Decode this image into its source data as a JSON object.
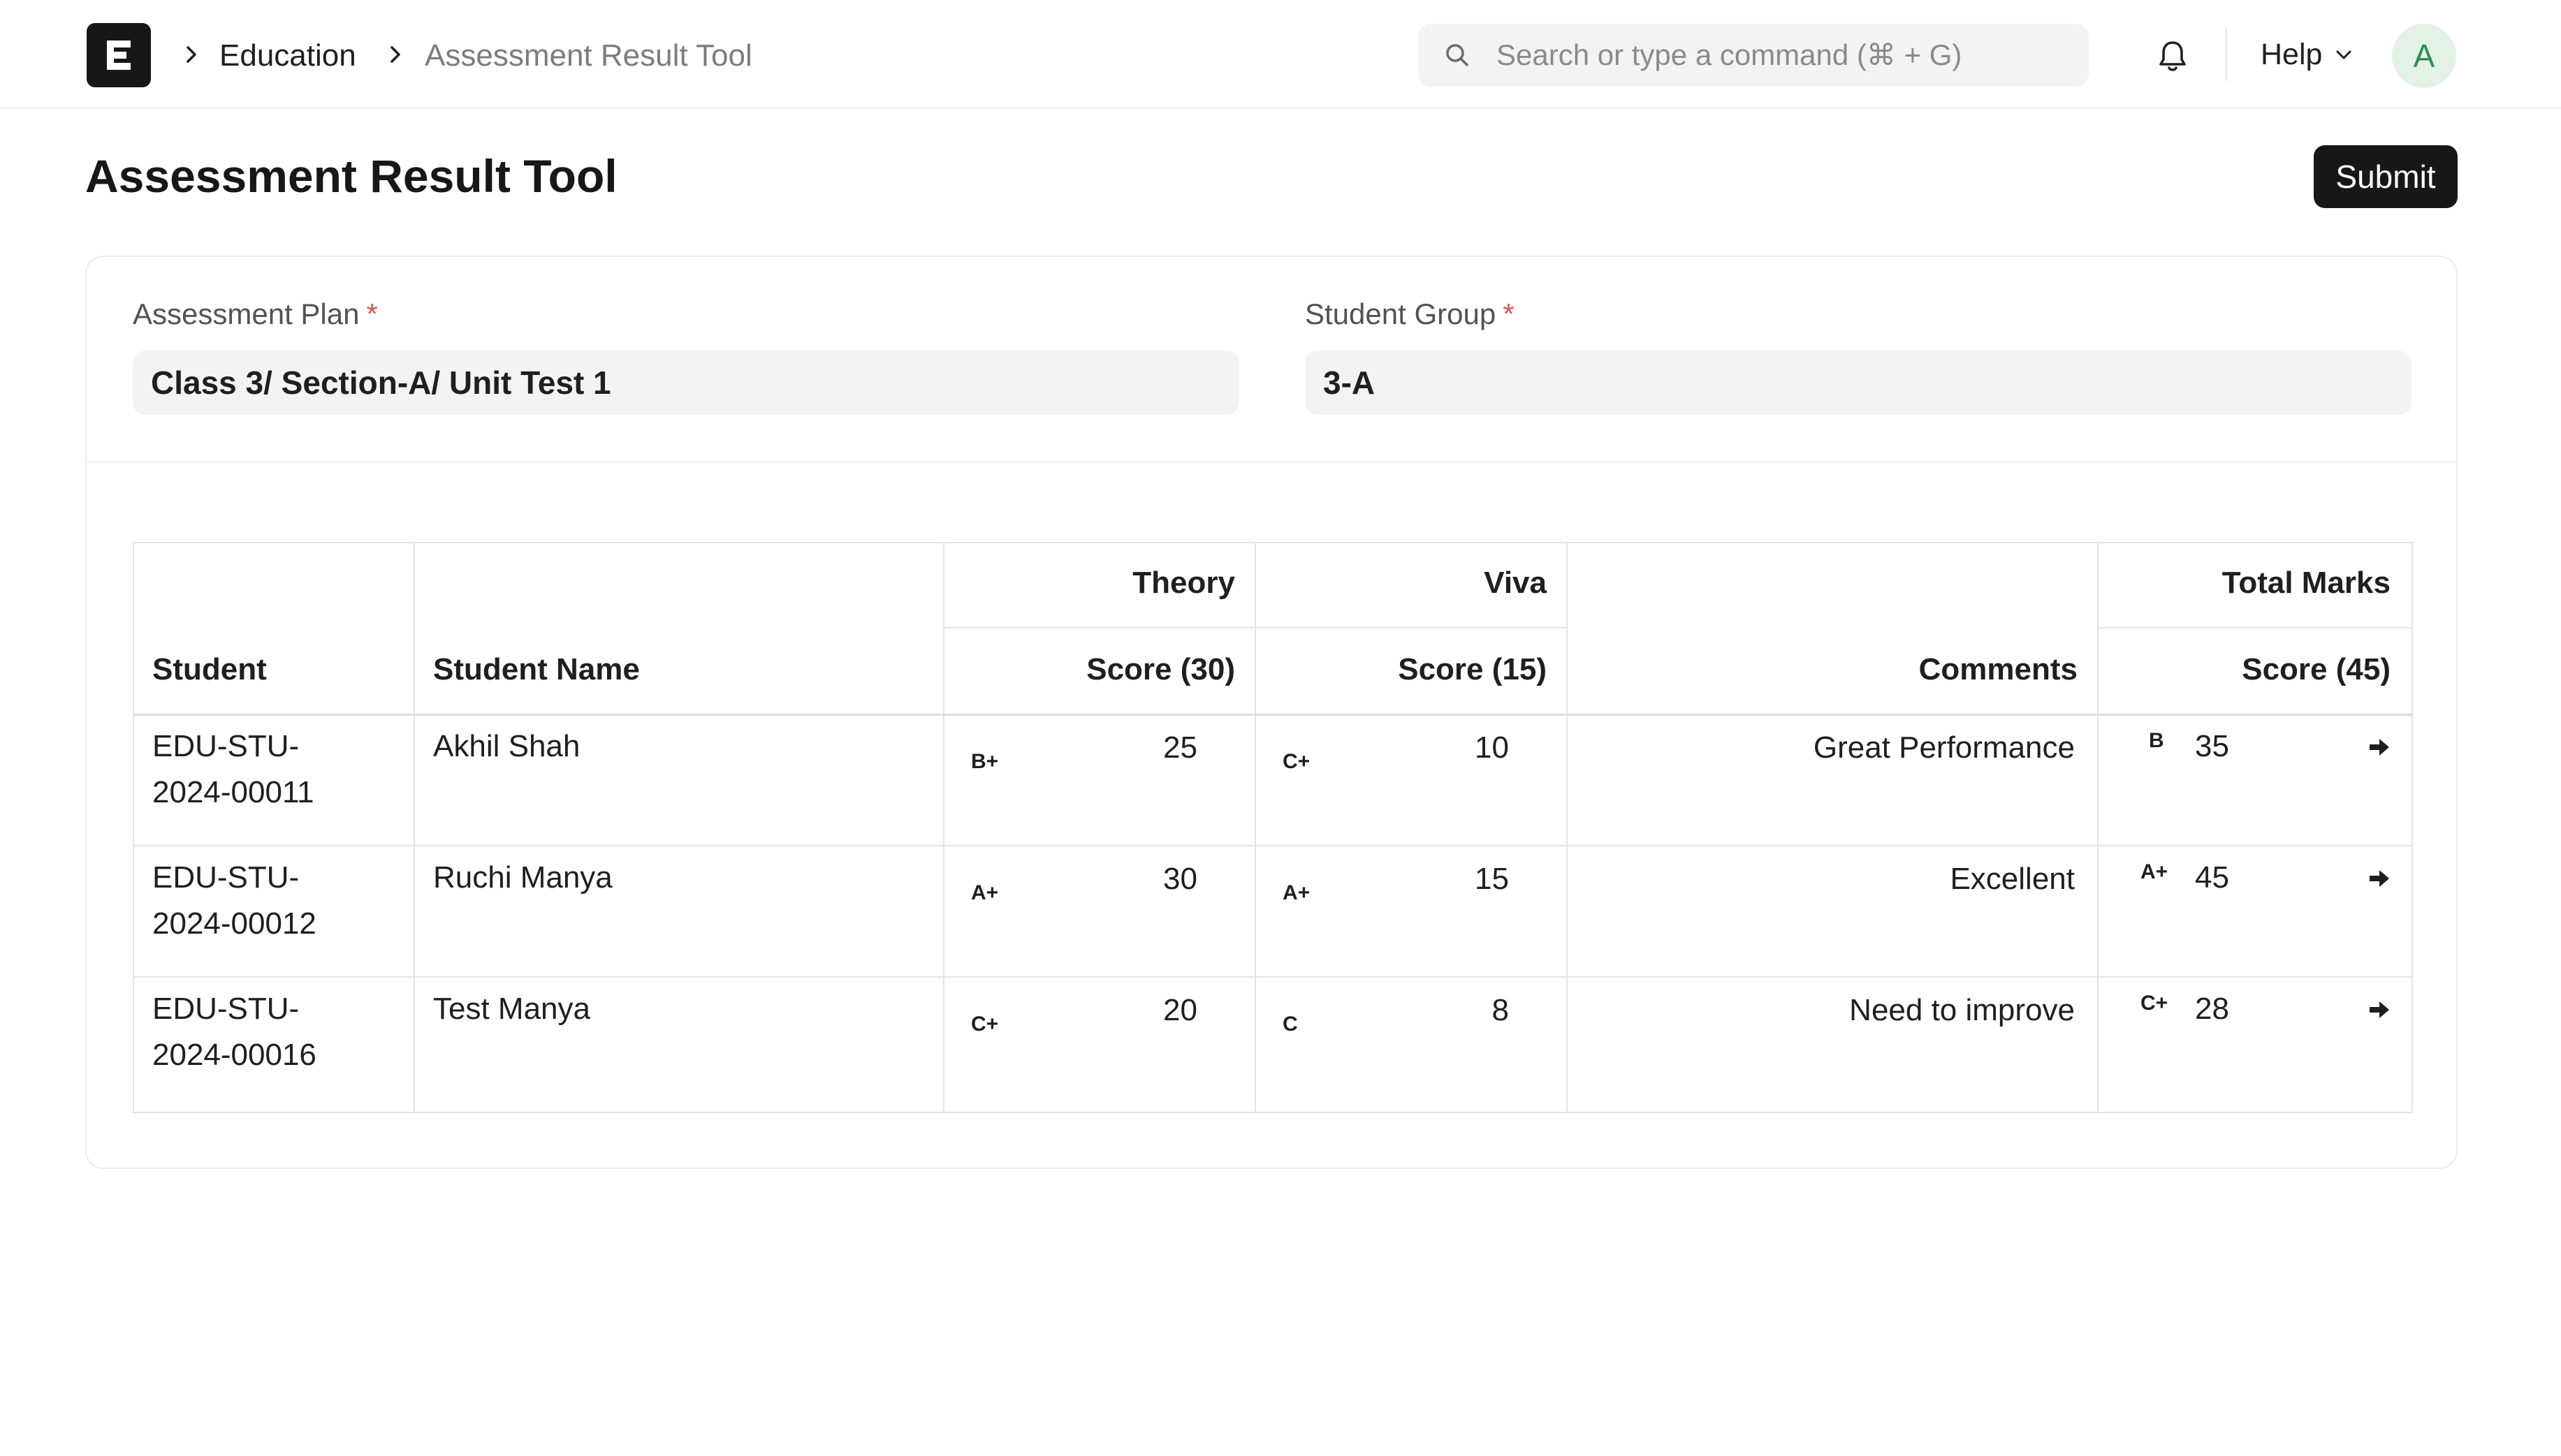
{
  "navbar": {
    "breadcrumbs": [
      {
        "label": "Education"
      },
      {
        "label": "Assessment Result Tool"
      }
    ],
    "search": {
      "placeholder": "Search or type a command (⌘ + G)"
    },
    "help_label": "Help",
    "avatar_initial": "A"
  },
  "page": {
    "title": "Assessment Result Tool",
    "submit_label": "Submit"
  },
  "form": {
    "assessment_plan": {
      "label": "Assessment Plan",
      "required_mark": "*",
      "value": "Class 3/ Section-A/ Unit Test 1"
    },
    "student_group": {
      "label": "Student Group",
      "required_mark": "*",
      "value": "3-A"
    }
  },
  "table": {
    "headers": {
      "student": "Student",
      "student_name": "Student Name",
      "theory": "Theory",
      "theory_score": "Score (30)",
      "viva": "Viva",
      "viva_score": "Score (15)",
      "comments": "Comments",
      "total": "Total Marks",
      "total_score": "Score (45)"
    },
    "rows": [
      {
        "student_line1": "EDU-STU-",
        "student_line2": "2024-00011",
        "name": "Akhil Shah",
        "theory_grade": "B+",
        "theory_score": "25",
        "viva_grade": "C+",
        "viva_score": "10",
        "comment": "Great Performance",
        "total_grade": "B",
        "total_score": "35"
      },
      {
        "student_line1": "EDU-STU-",
        "student_line2": "2024-00012",
        "name": "Ruchi Manya",
        "theory_grade": "A+",
        "theory_score": "30",
        "viva_grade": "A+",
        "viva_score": "15",
        "comment": "Excellent",
        "total_grade": "A+",
        "total_score": "45"
      },
      {
        "student_line1": "EDU-STU-",
        "student_line2": "2024-00016",
        "name": "Test Manya",
        "theory_grade": "C+",
        "theory_score": "20",
        "viva_grade": "C",
        "viva_score": "8",
        "comment": "Need to improve",
        "total_grade": "C+",
        "total_score": "28"
      }
    ]
  },
  "icons": {
    "logo": "frappe-e-logo",
    "breadcrumb_separator": "chevron-right-icon",
    "search": "search-icon",
    "notifications": "bell-icon",
    "help_dropdown": "chevron-down-icon",
    "row_action": "arrow-right-icon"
  },
  "colors": {
    "primary_button": "#171717",
    "required_mark": "#e0534f",
    "avatar_bg": "#e3f2e7",
    "avatar_text": "#2f8b52",
    "input_bg": "#f3f3f3",
    "border": "#e4e4e4"
  }
}
